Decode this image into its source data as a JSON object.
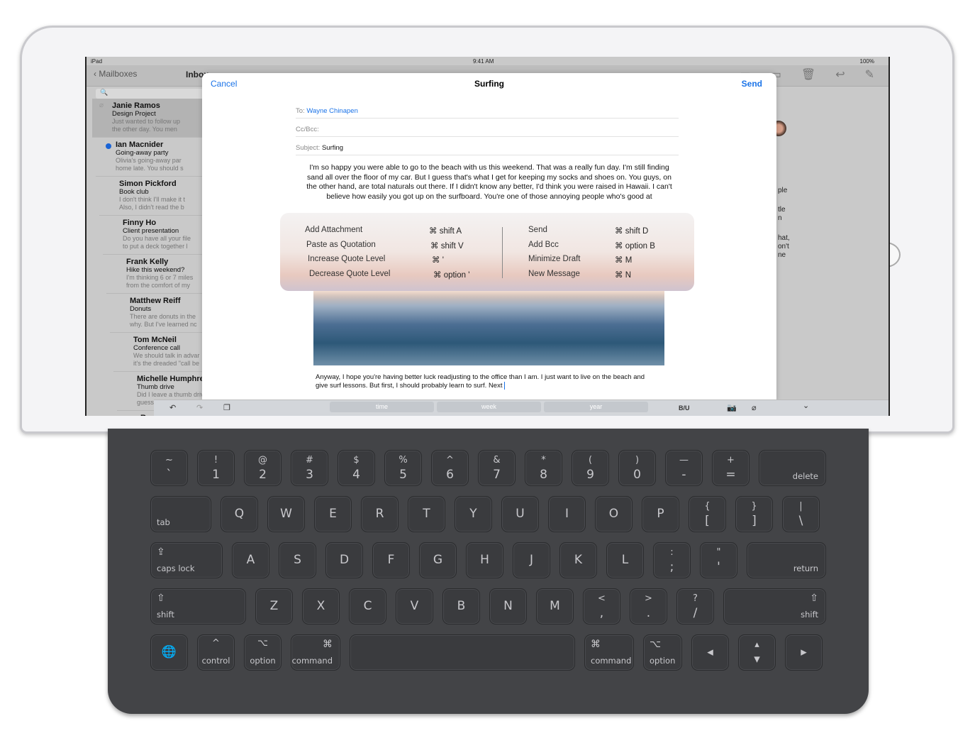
{
  "status": {
    "device": "iPad",
    "time": "9:41 AM",
    "battery": "100%"
  },
  "nav": {
    "back": "Mailboxes",
    "title": "Inbox",
    "icons": [
      "folder-icon",
      "move-icon",
      "trash-icon",
      "reply-icon",
      "compose-icon"
    ]
  },
  "list": {
    "search_placeholder": "🔍",
    "mails": [
      {
        "from": "Janie Ramos",
        "subject": "Design Project",
        "p1": "Just wanted to follow up",
        "p2": "the other day. You men",
        "selected": true,
        "attachment": true
      },
      {
        "from": "Ian Macnider",
        "subject": "Going-away party",
        "p1": "Olivia's going-away par",
        "p2": "home late. You should s",
        "unread": true
      },
      {
        "from": "Simon Pickford",
        "subject": "Book club",
        "p1": "I don't think I'll make it t",
        "p2": "Also, I didn't read the b"
      },
      {
        "from": "Finny Ho",
        "subject": "Client presentation",
        "p1": "Do you have all your file",
        "p2": "to put a deck together l"
      },
      {
        "from": "Frank Kelly",
        "subject": "Hike this weekend?",
        "p1": "I'm thinking 6 or 7 miles",
        "p2": "from the comfort of my"
      },
      {
        "from": "Matthew Reiff",
        "subject": "Donuts",
        "p1": "There are donuts in the",
        "p2": "why. But I've learned nc"
      },
      {
        "from": "Tom McNeil",
        "subject": "Conference call",
        "p1": "We should talk in advar",
        "p2": "it's the dreaded \"call be"
      },
      {
        "from": "Michelle Humphrey",
        "subject": "Thumb drive",
        "p1": "Did I leave a thumb driv",
        "p2": "guess it's lost forever. E"
      },
      {
        "from": "Ryan Notch",
        "subject": "",
        "p1": "",
        "p2": ""
      }
    ]
  },
  "compose": {
    "cancel": "Cancel",
    "title": "Surfing",
    "send": "Send",
    "to_label": "To:",
    "to": "Wayne Chinapen",
    "ccbcc_label": "Cc/Bcc:",
    "subject_label": "Subject:",
    "subject": "Surfing",
    "body": "I'm so happy you were able to go to the beach with us this weekend. That was a really fun day. I'm still finding sand all over the floor of my car. But I guess that's what I get for keeping my socks and shoes on. You guys, on the other hand, are total naturals out there. If I didn't know any better, I'd think you were raised in Hawaii. I can't believe how easily you got up on the surfboard. You're one of those annoying people who's good at",
    "body2": "Anyway, I hope you're having better luck readjusting to the office than I am. I just want to live on the beach and give surf lessons. But first, I should probably learn to surf. Next"
  },
  "peek": [
    "ple",
    "tle",
    "n",
    "hat,",
    "on't",
    "ne"
  ],
  "shortcuts": {
    "left": [
      {
        "name": "Add Attachment",
        "keys": "⌘ shift A"
      },
      {
        "name": "Paste as Quotation",
        "keys": "⌘ shift V"
      },
      {
        "name": "Increase Quote Level",
        "keys": "⌘ '"
      },
      {
        "name": "Decrease Quote Level",
        "keys": "⌘ option '"
      }
    ],
    "right": [
      {
        "name": "Send",
        "keys": "⌘ shift D"
      },
      {
        "name": "Add Bcc",
        "keys": "⌘ option B"
      },
      {
        "name": "Minimize Draft",
        "keys": "⌘ M"
      },
      {
        "name": "New Message",
        "keys": "⌘ N"
      }
    ]
  },
  "toolbar": {
    "undo": "↶",
    "redo": "↷",
    "paste": "❐",
    "predictions": [
      "time",
      "week",
      "year"
    ],
    "format": "B/U",
    "camera": "📷",
    "attach": "⌀",
    "hide": "⌄"
  },
  "keyboard": {
    "rows": [
      [
        {
          "t": "~",
          "b": "`"
        },
        {
          "t": "!",
          "b": "1"
        },
        {
          "t": "@",
          "b": "2"
        },
        {
          "t": "#",
          "b": "3"
        },
        {
          "t": "$",
          "b": "4"
        },
        {
          "t": "%",
          "b": "5"
        },
        {
          "t": "^",
          "b": "6"
        },
        {
          "t": "&",
          "b": "7"
        },
        {
          "t": "*",
          "b": "8"
        },
        {
          "t": "(",
          "b": "9"
        },
        {
          "t": ")",
          "b": "0"
        },
        {
          "t": "—",
          "b": "-"
        },
        {
          "t": "+",
          "b": "="
        },
        {
          "lblr": "delete"
        }
      ],
      [
        {
          "lbl": "tab"
        },
        {
          "b": "Q"
        },
        {
          "b": "W"
        },
        {
          "b": "E"
        },
        {
          "b": "R"
        },
        {
          "b": "T"
        },
        {
          "b": "Y"
        },
        {
          "b": "U"
        },
        {
          "b": "I"
        },
        {
          "b": "O"
        },
        {
          "b": "P"
        },
        {
          "t": "{",
          "b": "["
        },
        {
          "t": "}",
          "b": "]"
        },
        {
          "t": "|",
          "b": "\\"
        }
      ],
      [
        {
          "ic": "⇪",
          "lbl": "caps lock"
        },
        {
          "b": "A"
        },
        {
          "b": "S"
        },
        {
          "b": "D"
        },
        {
          "b": "F"
        },
        {
          "b": "G"
        },
        {
          "b": "H"
        },
        {
          "b": "J"
        },
        {
          "b": "K"
        },
        {
          "b": "L"
        },
        {
          "t": ":",
          "b": ";"
        },
        {
          "t": "\"",
          "b": "'"
        },
        {
          "lblr": "return"
        }
      ],
      [
        {
          "ic": "⇧",
          "lbl": "shift"
        },
        {
          "b": "Z"
        },
        {
          "b": "X"
        },
        {
          "b": "C"
        },
        {
          "b": "V"
        },
        {
          "b": "B"
        },
        {
          "b": "N"
        },
        {
          "b": "M"
        },
        {
          "t": "<",
          "b": ","
        },
        {
          "t": ">",
          "b": "."
        },
        {
          "t": "?",
          "b": "/"
        },
        {
          "icr": "⇧",
          "lblr": "shift"
        }
      ],
      [
        {
          "b": "🌐"
        },
        {
          "icc": "^",
          "lblc": "control"
        },
        {
          "icc": "⌥",
          "lblc": "option"
        },
        {
          "icr": "⌘",
          "lblr": "command"
        },
        {
          "b": ""
        },
        {
          "ic": "⌘",
          "lbl": "command"
        },
        {
          "ic": "⌥",
          "lbl": "option"
        },
        {
          "b": "◂"
        },
        {
          "t": "▴",
          "b": "▾"
        },
        {
          "b": "▸"
        }
      ]
    ]
  }
}
